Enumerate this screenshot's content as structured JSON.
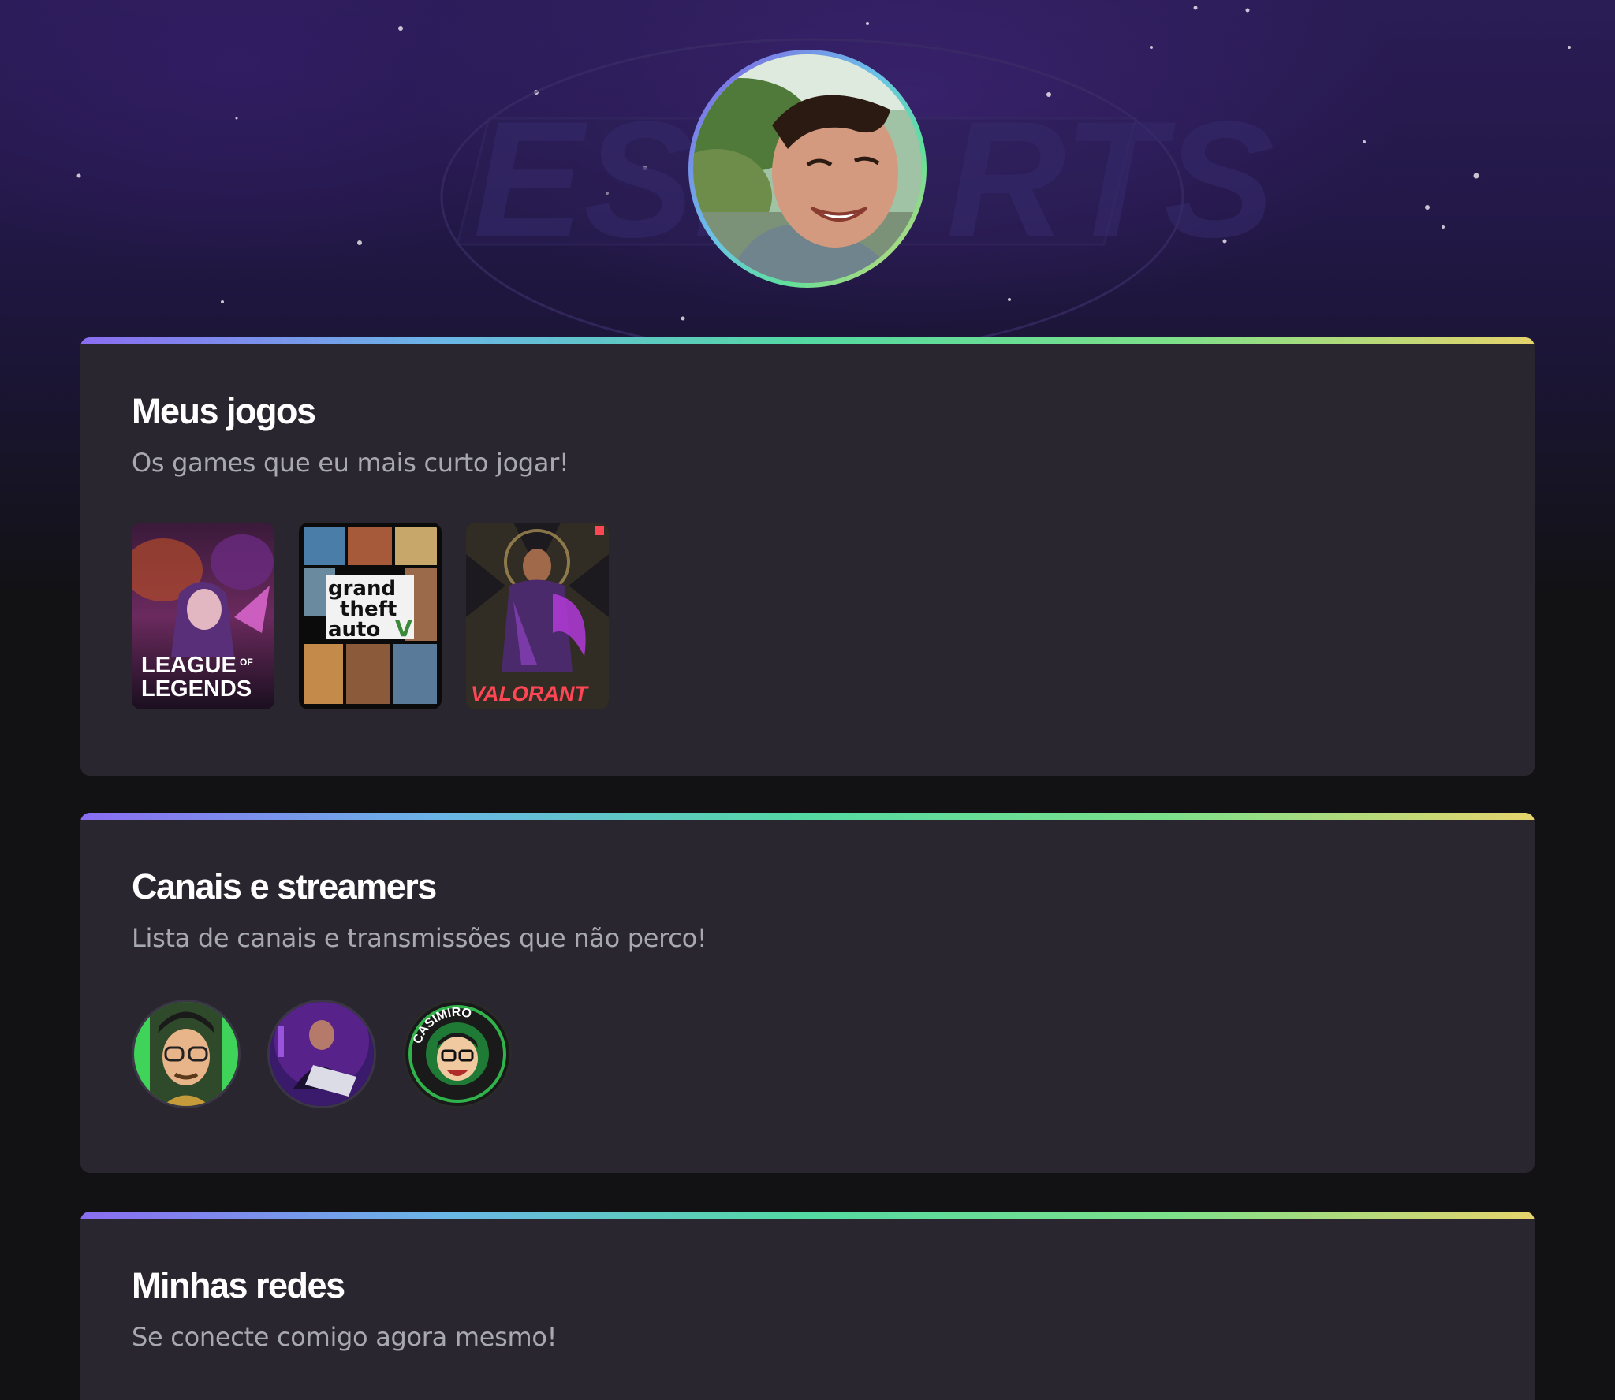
{
  "profile": {
    "avatar_icon": "profile-photo-icon"
  },
  "background": {
    "watermark_icon": "esports-logo-icon"
  },
  "sections": {
    "games": {
      "title": "Meus jogos",
      "subtitle": "Os games que eu mais curto jogar!",
      "items": [
        {
          "name": "LEAGUE OF LEGENDS",
          "logo_line1": "LEAGUE",
          "logo_of": "OF",
          "logo_line2": "LEGENDS"
        },
        {
          "name": "Grand Theft Auto V",
          "logo_line1": "grand",
          "logo_line2": "theft",
          "logo_line3": "auto",
          "logo_five": "V"
        },
        {
          "name": "VALORANT",
          "logo_line1": "VALORANT"
        }
      ]
    },
    "streamers": {
      "title": "Canais e streamers",
      "subtitle": "Lista de canais e transmissões que não perco!",
      "items": [
        {
          "icon": "streamer-avatar-1-icon"
        },
        {
          "icon": "streamer-avatar-2-icon"
        },
        {
          "icon": "casimiro-avatar-icon",
          "ring_text": "CASIMIRO"
        }
      ]
    },
    "socials": {
      "title": "Minhas redes",
      "subtitle": "Se conecte comigo agora mesmo!"
    }
  },
  "colors": {
    "page_bg": "#121214",
    "card_bg": "#29262f",
    "accent_gradient": [
      "#8a6df1",
      "#6ab6e6",
      "#53d9a2",
      "#e6d36c"
    ],
    "subtitle": "#a8a8b3"
  }
}
